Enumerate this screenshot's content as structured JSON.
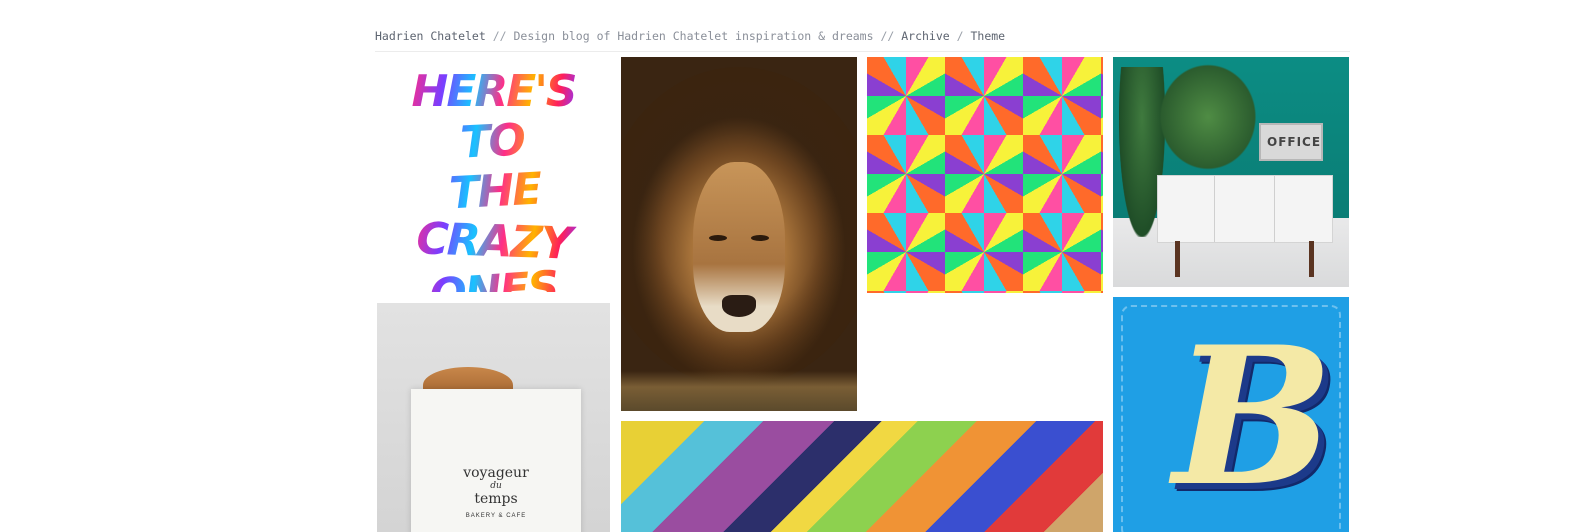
{
  "header": {
    "site_name": "Hadrien Chatelet",
    "separator_1": " // ",
    "tagline": "Design blog of Hadrien Chatelet inspiration & dreams",
    "separator_2": " // ",
    "archive_label": "Archive",
    "separator_3": " / ",
    "theme_label": "Theme"
  },
  "posts": {
    "lettering": {
      "lines": [
        "HERE'S",
        "TO THE",
        "CRAZY",
        "ONES"
      ]
    },
    "office_sign": "OFFICE",
    "bakery": {
      "brand_top": "voyageur",
      "brand_mid": "du",
      "brand_bottom": "temps",
      "brand_sub": "BAKERY & CAFE"
    },
    "b_poster": {
      "letter": "B"
    }
  },
  "colors": {
    "link": "#5d6470",
    "muted": "#8a8f99",
    "teal_wall": "#0a7d75",
    "poster_blue": "#1f9fe5"
  }
}
